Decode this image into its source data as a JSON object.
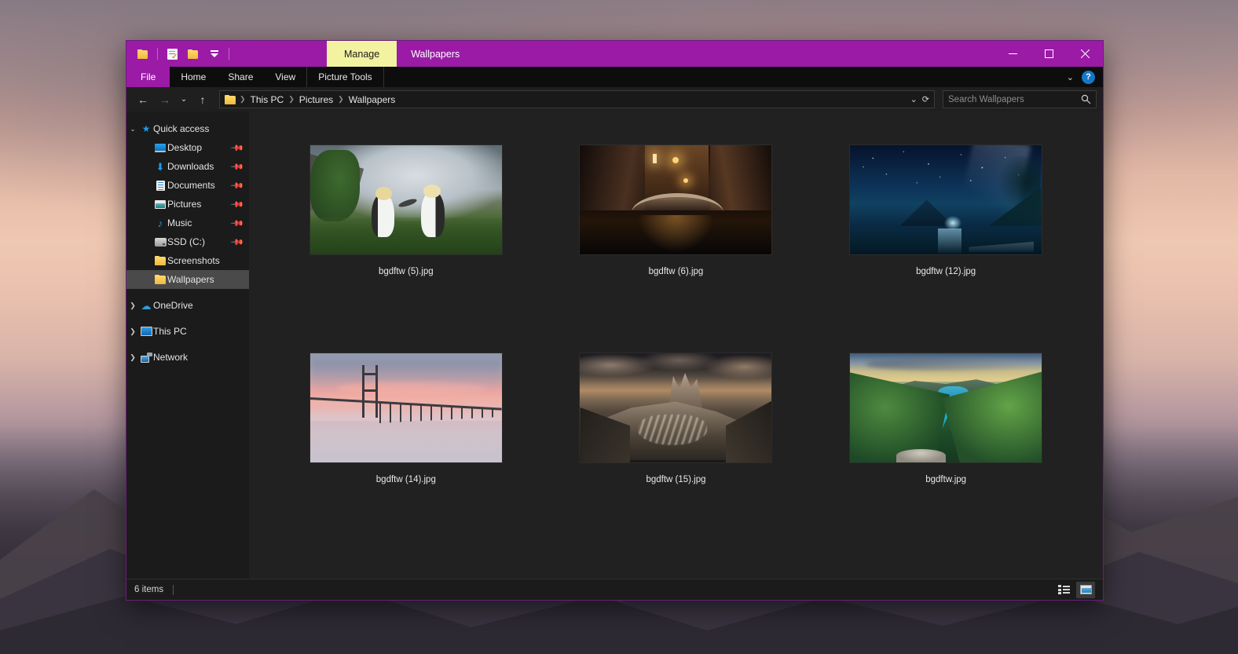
{
  "window": {
    "title": "Wallpapers",
    "contextual_tab_header": "Manage",
    "accent_color": "#9b1ba6",
    "contextual_tab_color": "#f2f2a0",
    "quick_access_toolbar": [
      {
        "name": "new-folder-icon",
        "glyph": "folder"
      },
      {
        "name": "properties-icon",
        "glyph": "properties"
      },
      {
        "name": "open-folder-icon",
        "glyph": "folder"
      },
      {
        "name": "customize-qat-dropdown",
        "glyph": "chevron"
      }
    ],
    "controls": {
      "minimize": "Minimize",
      "maximize": "Maximize",
      "close": "Close"
    }
  },
  "ribbon": {
    "tabs": [
      {
        "label": "File",
        "active": true
      },
      {
        "label": "Home",
        "active": false
      },
      {
        "label": "Share",
        "active": false
      },
      {
        "label": "View",
        "active": false
      },
      {
        "label": "Picture Tools",
        "active": false,
        "contextual": true
      }
    ],
    "expand_ribbon_label": "Expand the Ribbon",
    "help_label": "?"
  },
  "navbar": {
    "back": "Back",
    "forward": "Forward",
    "recent_locations": "Recent locations",
    "up": "Up one level",
    "breadcrumbs": [
      "This PC",
      "Pictures",
      "Wallpapers"
    ],
    "dropdown": "Previous locations",
    "refresh": "Refresh"
  },
  "search": {
    "placeholder": "Search Wallpapers",
    "value": ""
  },
  "sidebar": {
    "groups": [
      {
        "name": "Quick access",
        "icon": "star-icon",
        "expanded": true,
        "items": [
          {
            "label": "Desktop",
            "icon": "desktop-icon",
            "pinned": true
          },
          {
            "label": "Downloads",
            "icon": "downloads-icon",
            "pinned": true
          },
          {
            "label": "Documents",
            "icon": "documents-icon",
            "pinned": true
          },
          {
            "label": "Pictures",
            "icon": "pictures-icon",
            "pinned": true
          },
          {
            "label": "Music",
            "icon": "music-icon",
            "pinned": true
          },
          {
            "label": "SSD (C:)",
            "icon": "drive-icon",
            "pinned": true
          },
          {
            "label": "Screenshots",
            "icon": "folder-icon",
            "pinned": false
          },
          {
            "label": "Wallpapers",
            "icon": "folder-icon",
            "pinned": false,
            "selected": true
          }
        ]
      },
      {
        "name": "OneDrive",
        "icon": "cloud-icon",
        "expanded": false,
        "items": []
      },
      {
        "name": "This PC",
        "icon": "pc-icon",
        "expanded": false,
        "items": []
      },
      {
        "name": "Network",
        "icon": "network-icon",
        "expanded": false,
        "items": []
      }
    ]
  },
  "files": [
    {
      "name": "bgdftw (5).jpg",
      "art": "t1",
      "description": "two penguins on grass"
    },
    {
      "name": "bgdftw (6).jpg",
      "art": "t2",
      "description": "venice canal at night"
    },
    {
      "name": "bgdftw (12).jpg",
      "art": "t3",
      "description": "starry night over lake"
    },
    {
      "name": "bgdftw (14).jpg",
      "art": "t4",
      "description": "bridge at sunset"
    },
    {
      "name": "bgdftw (15).jpg",
      "art": "t5",
      "description": "dolomites mountain peaks"
    },
    {
      "name": "bgdftw.jpg",
      "art": "t6",
      "description": "plitvice lakes turquoise water"
    }
  ],
  "statusbar": {
    "item_count": "6 items",
    "views": [
      {
        "name": "details-view",
        "label": "Details",
        "active": false
      },
      {
        "name": "large-icons-view",
        "label": "Large icons",
        "active": true
      }
    ]
  }
}
